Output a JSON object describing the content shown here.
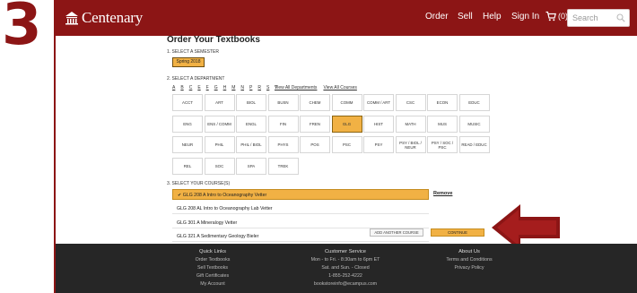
{
  "step": {
    "number": "3"
  },
  "colors": {
    "brand": "#8c1515",
    "accent": "#f1b144",
    "footer": "#262626"
  },
  "header": {
    "logo_text": "Centenary",
    "logo_icon": "building-icon",
    "nav": {
      "order": "Order",
      "sell": "Sell",
      "help": "Help",
      "signin": "Sign In"
    },
    "cart_count": "(0)",
    "search_placeholder": "Search"
  },
  "main": {
    "title": "Order Your Textbooks",
    "step1_label": "1. SELECT A SEMESTER",
    "semester": "Spring 2018",
    "step2_label": "2. SELECT A DEPARTMENT",
    "alphabet": [
      "A",
      "B",
      "C",
      "E",
      "F",
      "G",
      "H",
      "M",
      "N",
      "P",
      "R",
      "S",
      "T"
    ],
    "view_all_departments": "View All Departments",
    "view_all_courses": "View All Courses",
    "departments": [
      [
        "ACCT",
        "ART",
        "BIOL",
        "BUSN",
        "CHEM",
        "COMM",
        "COMM / ART",
        "CSC",
        "ECON",
        "EDUC"
      ],
      [
        "ENG",
        "ENS / COMM",
        "ENGL",
        "FIN",
        "FREN",
        "GLG",
        "HIST",
        "MATH",
        "MUS",
        "MUSIC"
      ],
      [
        "NEUR",
        "PHIL",
        "PHIL / BIOL",
        "PHYS",
        "POS",
        "PSC",
        "PSY",
        "PSY / BIOL / NEUR",
        "PSY / SOC / PSC",
        "READ / EDUC"
      ],
      [
        "REL",
        "SOC",
        "SPA",
        "TREK"
      ]
    ],
    "selected_department": "GLG",
    "step3_label": "3. SELECT YOUR COURSE(S)",
    "courses": [
      "✔ GLG 208 A  Intro to Oceanography Vetter",
      "GLG 208 AL  Intro to Oceanography Lab Vetter",
      "GLG 301 A  Mineralogy Vetter",
      "GLG 321 A  Sedimentary Geology Bieler"
    ],
    "remove_label": "Remove",
    "add_course_label": "ADD ANOTHER COURSE",
    "continue_label": "CONTINUE"
  },
  "footer": {
    "quick_links": {
      "heading": "Quick Links",
      "items": [
        "Order Textbooks",
        "Sell Textbooks",
        "Gift Certificates",
        "My Account"
      ]
    },
    "customer_service": {
      "heading": "Customer Service",
      "items": [
        "Mon - to Fri. - 8:30am to 6pm ET",
        "Sat. and Sun. - Closed",
        "1-855-252-4222",
        "bookstoreinfo@ecampus.com"
      ]
    },
    "about_us": {
      "heading": "About Us",
      "items": [
        "Terms and Conditions",
        "Privacy Policy"
      ]
    }
  }
}
